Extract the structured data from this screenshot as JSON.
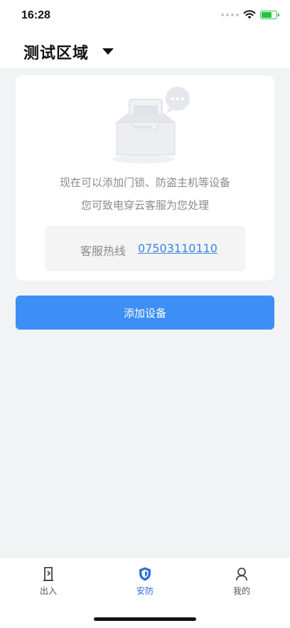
{
  "status_bar": {
    "time": "16:28",
    "battery_level": 0.75
  },
  "header": {
    "region_title": "测试区域"
  },
  "empty_card": {
    "line1": "现在可以添加门锁、防盗主机等设备",
    "line2": "您可致电穿云客服为您处理",
    "hotline_label": "客服热线",
    "hotline_number": "07503110110"
  },
  "actions": {
    "add_device_label": "添加设备"
  },
  "tab_bar": {
    "tabs": [
      {
        "label": "出入",
        "icon": "door-exit-icon",
        "active": false
      },
      {
        "label": "安防",
        "icon": "shield-icon",
        "active": true
      },
      {
        "label": "我的",
        "icon": "user-icon",
        "active": false
      }
    ]
  },
  "colors": {
    "accent": "#3d8ff5",
    "link": "#3a84e8",
    "active_tab": "#2e6fd8",
    "background": "#f2f3f5"
  }
}
